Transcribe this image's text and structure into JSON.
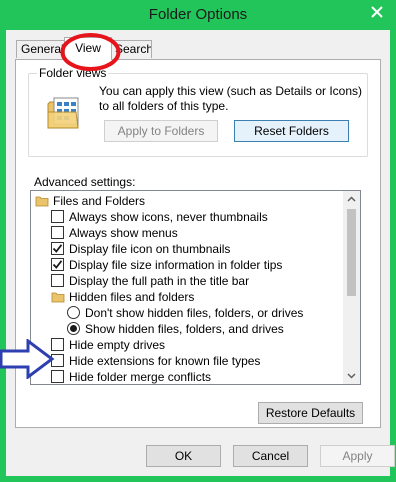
{
  "window": {
    "title": "Folder Options",
    "close_glyph": "✕"
  },
  "tabs": {
    "general": "General",
    "view": "View",
    "search": "Search"
  },
  "folder_views": {
    "legend": "Folder views",
    "icon": "folder-views-icon",
    "description": "You can apply this view (such as Details or Icons) to all folders of this type.",
    "apply_label": "Apply to Folders",
    "reset_label": "Reset Folders"
  },
  "advanced": {
    "label": "Advanced settings:",
    "items": [
      {
        "type": "folder",
        "label": "Files and Folders"
      },
      {
        "type": "checkbox",
        "label": "Always show icons, never thumbnails",
        "checked": false
      },
      {
        "type": "checkbox",
        "label": "Always show menus",
        "checked": false
      },
      {
        "type": "checkbox",
        "label": "Display file icon on thumbnails",
        "checked": true
      },
      {
        "type": "checkbox",
        "label": "Display file size information in folder tips",
        "checked": true
      },
      {
        "type": "checkbox",
        "label": "Display the full path in the title bar",
        "checked": false
      },
      {
        "type": "folder",
        "label": "Hidden files and folders"
      },
      {
        "type": "radio",
        "label": "Don't show hidden files, folders, or drives",
        "checked": false
      },
      {
        "type": "radio",
        "label": "Show hidden files, folders, and drives",
        "checked": true
      },
      {
        "type": "checkbox",
        "label": "Hide empty drives",
        "checked": false
      },
      {
        "type": "checkbox",
        "label": "Hide extensions for known file types",
        "checked": false
      },
      {
        "type": "checkbox",
        "label": "Hide folder merge conflicts",
        "checked": false
      }
    ]
  },
  "buttons": {
    "restore_defaults": "Restore Defaults",
    "ok": "OK",
    "cancel": "Cancel",
    "apply": "Apply"
  },
  "colors": {
    "window_frame": "#22c55a",
    "annotation_circle": "#e8141b",
    "annotation_arrow": "#2e3fb0",
    "close_button": "#c7413a"
  }
}
